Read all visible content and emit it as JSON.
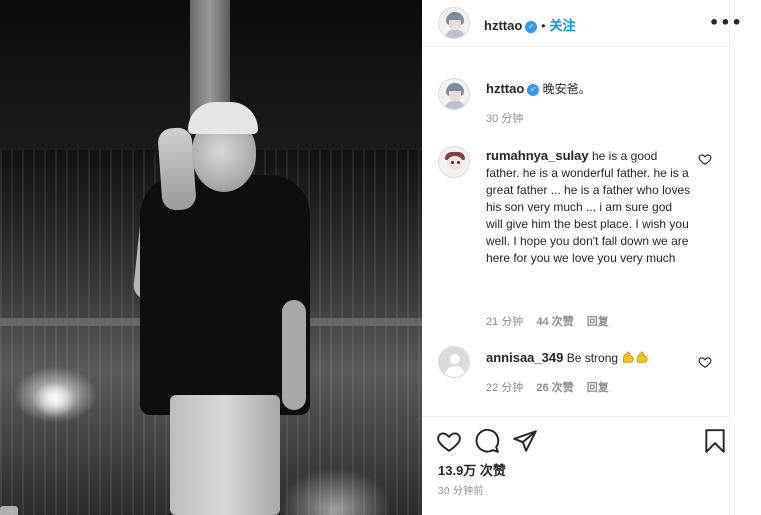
{
  "post": {
    "author": "hzttao",
    "follow_label": "关注",
    "separator": "•",
    "more_label": "•••"
  },
  "caption": {
    "author": "hzttao",
    "text": "晚安爸。",
    "time": "30 分钟"
  },
  "comments": [
    {
      "author": "rumahnya_sulay",
      "text": "he is a good father. he is a wonderful father. he is a great father ... he is a father who loves his son very much ... i am sure god will give him the best place. I wish you well. I hope you don't fall down we are here for you we love you very much",
      "time": "21 分钟",
      "likes": "44 次赞",
      "reply": "回复"
    },
    {
      "author": "annisaa_349",
      "text": "Be strong",
      "time": "22 分钟",
      "likes": "26 次赞",
      "reply": "回复"
    }
  ],
  "footer": {
    "likes": "13.9万 次赞",
    "time_ago": "30 分钟前"
  },
  "icons": {
    "verified": "verified-badge-icon",
    "like": "heart-icon",
    "comment": "comment-bubble-icon",
    "share": "paper-plane-icon",
    "save": "bookmark-icon",
    "strong": "flexed-biceps-icon"
  },
  "colors": {
    "accent": "#0095f6",
    "verified": "#3897f0",
    "muted": "#8e8e8e",
    "text": "#262626",
    "emoji": "#f5c518"
  }
}
